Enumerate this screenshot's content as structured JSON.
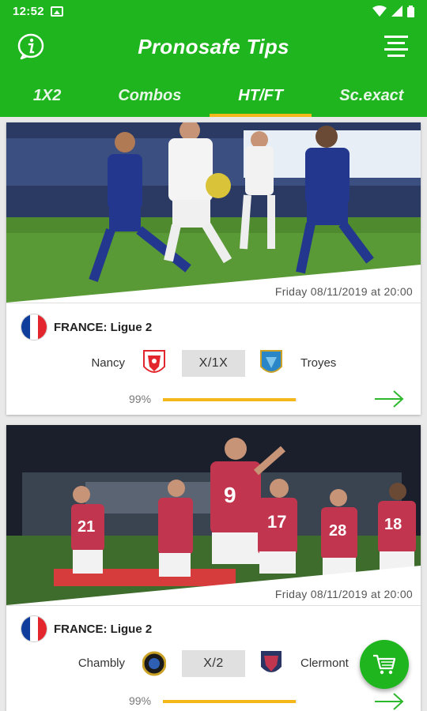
{
  "status_bar": {
    "time": "12:52"
  },
  "app_bar": {
    "title": "Pronosafe Tips"
  },
  "tabs": [
    {
      "label": "1X2"
    },
    {
      "label": "Combos"
    },
    {
      "label": "HT/FT",
      "active": true
    },
    {
      "label": "Sc.exact"
    }
  ],
  "matches": [
    {
      "date": "Friday 08/11/2019  at 20:00",
      "league": "FRANCE: Ligue 2",
      "home_team": "Nancy",
      "away_team": "Troyes",
      "pick": "X/1X",
      "confidence_label": "99%",
      "confidence": 0.99
    },
    {
      "date": "Friday 08/11/2019  at 20:00",
      "league": "FRANCE: Ligue 2",
      "home_team": "Chambly",
      "away_team": "Clermont",
      "pick": "X/2",
      "confidence_label": "99%",
      "confidence": 0.99
    }
  ],
  "icons": {
    "info": "info-icon",
    "menu": "menu-icon",
    "arrow": "arrow-right-icon",
    "cart": "cart-icon"
  },
  "colors": {
    "primary": "#1fb51f",
    "accent": "#f4b81a",
    "flag_blue": "#0f3d9c",
    "flag_red": "#e3262d"
  }
}
